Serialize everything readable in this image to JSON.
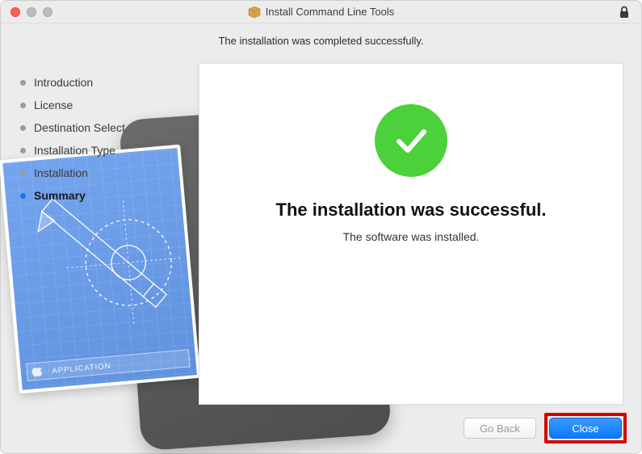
{
  "window": {
    "title": "Install Command Line Tools"
  },
  "subtitle": "The installation was completed successfully.",
  "steps": [
    {
      "label": "Introduction",
      "active": false
    },
    {
      "label": "License",
      "active": false
    },
    {
      "label": "Destination Select",
      "active": false
    },
    {
      "label": "Installation Type",
      "active": false
    },
    {
      "label": "Installation",
      "active": false
    },
    {
      "label": "Summary",
      "active": true
    }
  ],
  "panel": {
    "headline": "The installation was successful.",
    "subline": "The software was installed."
  },
  "buttons": {
    "go_back": "Go Back",
    "close": "Close"
  },
  "colors": {
    "accent_blue": "#0a7aff",
    "success_green": "#4cd13a",
    "highlight_red": "#d40000"
  }
}
